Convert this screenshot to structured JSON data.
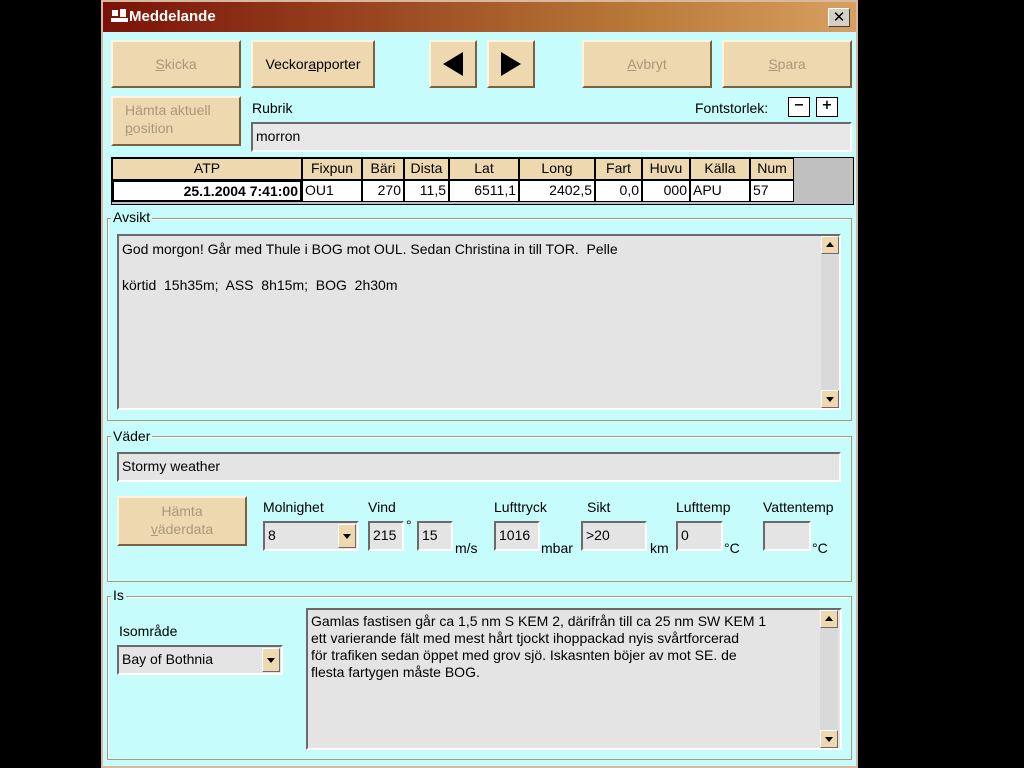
{
  "window": {
    "title": "Meddelande",
    "icon": "ship-icon"
  },
  "toolbar": {
    "send": {
      "pre": "",
      "key": "S",
      "post": "kicka"
    },
    "weekly": {
      "pre": "Veckor",
      "key": "a",
      "post": "pporter"
    },
    "prev_icon": "triangle-left-icon",
    "next_icon": "triangle-right-icon",
    "cancel": {
      "pre": "",
      "key": "A",
      "post": "vbryt"
    },
    "save": {
      "pre": "",
      "key": "S",
      "post": "para"
    },
    "get_position": {
      "line1": "Hämta aktuell",
      "key": "p",
      "line2": "osition"
    }
  },
  "subject": {
    "label": "Rubrik",
    "value": "morron"
  },
  "font_size": {
    "label": "Fontstorlek:",
    "decrease": "−",
    "increase": "+"
  },
  "grid": {
    "headers": [
      "ATP",
      "Fixpun",
      "Bäri",
      "Dista",
      "Lat",
      "Long",
      "Fart",
      "Huvu",
      "Källa",
      "Num"
    ],
    "row": [
      "25.1.2004 7:41:00",
      "OU1",
      "270",
      "11,5",
      "6511,1",
      "2402,5",
      "0,0",
      "000",
      "APU",
      "57"
    ]
  },
  "intent": {
    "legend": "Avsikt",
    "text": "God morgon! Går med Thule i BOG mot OUL. Sedan Christina in till TOR.  Pelle\n\nkörtid  15h35m;  ASS  8h15m;  BOG  2h30m"
  },
  "weather": {
    "legend": "Väder",
    "description": "Stormy weather",
    "get_button": {
      "line1": "Hämta",
      "key": "v",
      "line2": "äderdata"
    },
    "cloud": {
      "label": "Molnighet",
      "value": "8"
    },
    "wind": {
      "label": "Vind",
      "dir": "215",
      "deg": "°",
      "speed": "15",
      "unit": "m/s"
    },
    "pressure": {
      "label": "Lufttryck",
      "value": "1016",
      "unit": "mbar"
    },
    "visibility": {
      "label": "Sikt",
      "value": ">20",
      "unit": "km"
    },
    "air_temp": {
      "label": "Lufttemp",
      "value": "0",
      "unit": "°C"
    },
    "water_temp": {
      "label": "Vattentemp",
      "value": "",
      "unit": "°C"
    }
  },
  "ice": {
    "legend": "Is",
    "area_label": "Isområde",
    "area_value": "Bay of Bothnia",
    "text": "Gamlas fastisen går ca 1,5 nm S KEM 2, därifrån till ca 25 nm SW KEM 1\nett varierande fält med mest hårt tjockt ihoppackad nyis svårtforcerad\nför trafiken sedan öppet med grov sjö. Iskasnten böjer av mot SE. de\nflesta fartygen måste BOG."
  }
}
